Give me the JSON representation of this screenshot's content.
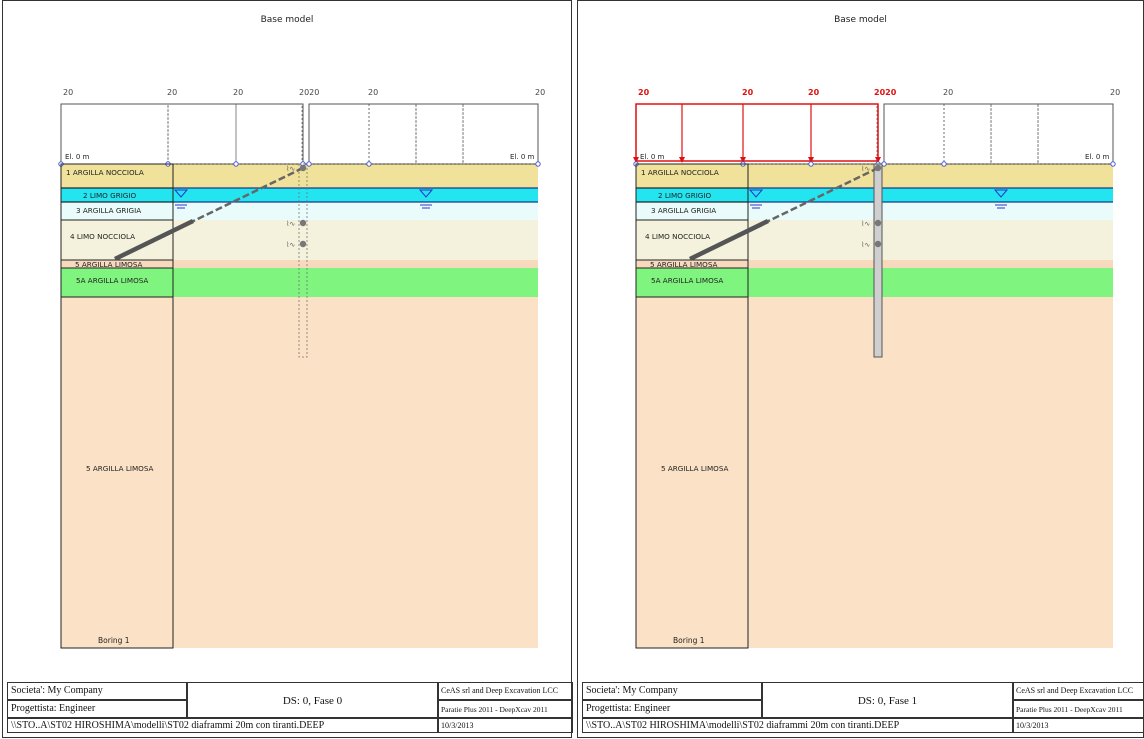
{
  "panels": [
    {
      "title": "Base model",
      "surcharge_labels": [
        "20",
        "20",
        "20",
        "2020",
        "20",
        "20"
      ],
      "elevation_labels": [
        "El. 0 m",
        "El. 0 m"
      ],
      "strata": [
        "1 ARGILLA NOCCIOLA",
        "2 LIMO GRIGIO",
        "3 ARGILLA GRIGIA",
        "4 LIMO NOCCIOLA",
        "5 ARGILLA LIMOSA",
        "5A ARGILLA LIMOSA",
        "5 ARGILLA LIMOSA"
      ],
      "boring_label": "Boring 1",
      "company": "Societa': My Company",
      "designer": "Progettista: Engineer",
      "stage": "DS: 0, Fase 0",
      "firm": "CeAS srl and Deep Excavation LCC",
      "program": "Paratie Plus 2011 - DeepXcav 2011",
      "path": "\\\\STO..A\\ST02 HIROSHIMA\\modelli\\ST02 diaframmi 20m con tiranti.DEEP",
      "date": "10/3/2013",
      "surcharge_active": false,
      "wall_installed": false
    },
    {
      "title": "Base model",
      "surcharge_labels": [
        "20",
        "20",
        "20",
        "2020",
        "20",
        "20"
      ],
      "elevation_labels": [
        "El. 0 m",
        "El. 0 m"
      ],
      "strata": [
        "1 ARGILLA NOCCIOLA",
        "2 LIMO GRIGIO",
        "3 ARGILLA GRIGIA",
        "4 LIMO NOCCIOLA",
        "5 ARGILLA LIMOSA",
        "5A ARGILLA LIMOSA",
        "5 ARGILLA LIMOSA"
      ],
      "boring_label": "Boring 1",
      "company": "Societa': My Company",
      "designer": "Progettista: Engineer",
      "stage": "DS: 0, Fase 1",
      "firm": "CeAS srl and Deep Excavation LCC",
      "program": "Paratie Plus 2011 - DeepXcav 2011",
      "path": "\\\\STO..A\\ST02 HIROSHIMA\\modelli\\ST02 diaframmi 20m con tiranti.DEEP",
      "date": "10/3/2013",
      "surcharge_active": true,
      "wall_installed": true
    }
  ],
  "colors": {
    "layer1": "#f0e29a",
    "layer2": "#22e5f0",
    "layer3": "#e9fbfb",
    "layer4": "#f4f2dc",
    "layer5a_thin": "#f7d9bd",
    "layer5a": "#7ff57f",
    "layer5": "#fbe2c7",
    "surcharge_active": "#e01010",
    "water_symbol": "#3030d0",
    "wall": "#cfcfcf"
  }
}
